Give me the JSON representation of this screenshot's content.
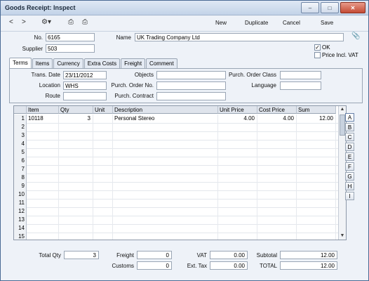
{
  "window": {
    "title": "Goods Receipt: Inspect",
    "buttons": [
      "–",
      "□",
      "✕"
    ]
  },
  "toolbar": {
    "back": "<",
    "forward": ">",
    "gear": "⚙▾",
    "print": "⎙",
    "preview": "⎙",
    "new": "New",
    "duplicate": "Duplicate",
    "cancel": "Cancel",
    "save": "Save"
  },
  "header": {
    "no_label": "No.",
    "no_value": "6165",
    "supplier_label": "Supplier",
    "supplier_value": "503",
    "name_label": "Name",
    "name_value": "UK Trading Company Ltd",
    "ok_label": "OK",
    "ok_checked": "✓",
    "price_incl_vat_label": "Price Incl. VAT",
    "price_incl_vat_checked": ""
  },
  "tabs": [
    "Terms",
    "Items",
    "Currency",
    "Extra Costs",
    "Freight",
    "Comment"
  ],
  "terms": {
    "trans_date_label": "Trans. Date",
    "trans_date_value": "23/11/2012",
    "location_label": "Location",
    "location_value": "WHS",
    "route_label": "Route",
    "route_value": "",
    "objects_label": "Objects",
    "objects_value": "",
    "purch_order_no_label": "Purch. Order No.",
    "purch_order_no_value": "",
    "purch_contract_label": "Purch. Contract",
    "purch_contract_value": "",
    "purch_order_class_label": "Purch. Order Class",
    "purch_order_class_value": "",
    "language_label": "Language",
    "language_value": ""
  },
  "grid": {
    "columns": [
      "Item",
      "Qty",
      "Unit",
      "Description",
      "Unit Price",
      "Cost Price",
      "Sum"
    ],
    "row_numbers": [
      "1",
      "2",
      "3",
      "4",
      "5",
      "6",
      "7",
      "8",
      "9",
      "10",
      "11",
      "12",
      "13",
      "14",
      "15"
    ],
    "rows": [
      {
        "item": "10118",
        "qty": "3",
        "unit": "",
        "description": "Personal Stereo",
        "unit_price": "4.00",
        "cost_price": "4.00",
        "sum": "12.00"
      }
    ],
    "scroll_up": "▲",
    "scroll_down": "▼"
  },
  "side_buttons": [
    "A",
    "B",
    "C",
    "D",
    "E",
    "F",
    "G",
    "H",
    "I"
  ],
  "footer": {
    "total_qty_label": "Total Qty",
    "total_qty_value": "3",
    "freight_label": "Freight",
    "freight_value": "0",
    "customs_label": "Customs",
    "customs_value": "0",
    "vat_label": "VAT",
    "vat_value": "0.00",
    "ext_tax_label": "Ext. Tax",
    "ext_tax_value": "0.00",
    "subtotal_label": "Subtotal",
    "subtotal_value": "12.00",
    "total_label": "TOTAL",
    "total_value": "12.00"
  },
  "icons": {
    "gear": "gear-icon",
    "print": "print-icon",
    "preview": "print-preview-icon",
    "attach": "paperclip-icon"
  }
}
